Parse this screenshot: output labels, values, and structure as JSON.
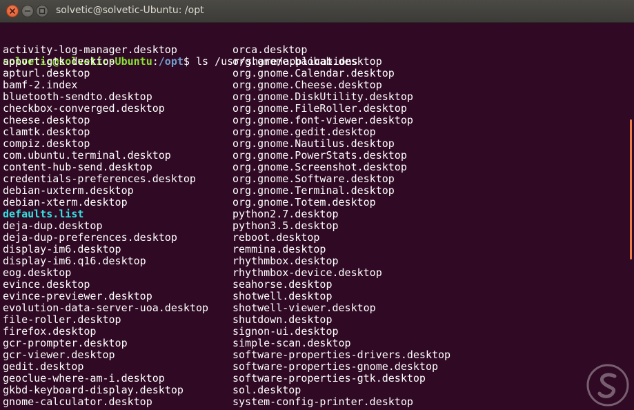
{
  "window": {
    "title": "solvetic@solvetic-Ubuntu: /opt"
  },
  "prompt": {
    "user_host": "solvetic@solvetic-Ubuntu",
    "colon": ":",
    "path": "/opt",
    "symbol": "$",
    "command": " ls /usr/share/applications"
  },
  "listing": {
    "left": [
      "activity-log-manager.desktop",
      "apport-gtk.desktop",
      "apturl.desktop",
      "bamf-2.index",
      "bluetooth-sendto.desktop",
      "checkbox-converged.desktop",
      "cheese.desktop",
      "clamtk.desktop",
      "compiz.desktop",
      "com.ubuntu.terminal.desktop",
      "content-hub-send.desktop",
      "credentials-preferences.desktop",
      "debian-uxterm.desktop",
      "debian-xterm.desktop",
      "defaults.list",
      "deja-dup.desktop",
      "deja-dup-preferences.desktop",
      "display-im6.desktop",
      "display-im6.q16.desktop",
      "eog.desktop",
      "evince.desktop",
      "evince-previewer.desktop",
      "evolution-data-server-uoa.desktop",
      "file-roller.desktop",
      "firefox.desktop",
      "gcr-prompter.desktop",
      "gcr-viewer.desktop",
      "gedit.desktop",
      "geoclue-where-am-i.desktop",
      "gkbd-keyboard-display.desktop",
      "gnome-calculator.desktop"
    ],
    "right": [
      "orca.desktop",
      "org.gnome.baobab.desktop",
      "org.gnome.Calendar.desktop",
      "org.gnome.Cheese.desktop",
      "org.gnome.DiskUtility.desktop",
      "org.gnome.FileRoller.desktop",
      "org.gnome.font-viewer.desktop",
      "org.gnome.gedit.desktop",
      "org.gnome.Nautilus.desktop",
      "org.gnome.PowerStats.desktop",
      "org.gnome.Screenshot.desktop",
      "org.gnome.Software.desktop",
      "org.gnome.Terminal.desktop",
      "org.gnome.Totem.desktop",
      "python2.7.desktop",
      "python3.5.desktop",
      "reboot.desktop",
      "remmina.desktop",
      "rhythmbox.desktop",
      "rhythmbox-device.desktop",
      "seahorse.desktop",
      "shotwell.desktop",
      "shotwell-viewer.desktop",
      "shutdown.desktop",
      "signon-ui.desktop",
      "simple-scan.desktop",
      "software-properties-drivers.desktop",
      "software-properties-gnome.desktop",
      "software-properties-gtk.desktop",
      "sol.desktop",
      "system-config-printer.desktop"
    ],
    "highlighted_entry": "defaults.list"
  },
  "colors": {
    "background": "#300a24",
    "text": "#ffffff",
    "prompt_user": "#8ae234",
    "prompt_path": "#729fcf",
    "highlight": "#34e2e2",
    "accent": "#ef7f4a"
  },
  "icons": {
    "close": "close-icon",
    "minimize": "minimize-icon",
    "maximize": "maximize-icon",
    "watermark": "solvetic-logo-icon"
  }
}
